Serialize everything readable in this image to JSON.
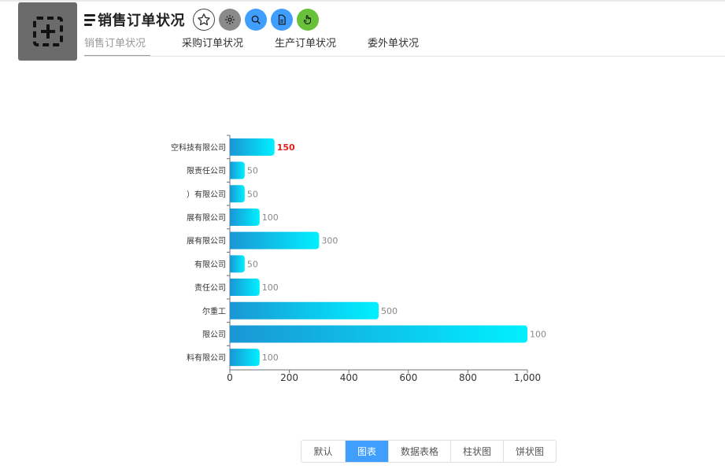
{
  "header": {
    "title": "销售订单状况",
    "actions": [
      {
        "id": "favorite",
        "icon": "star-icon"
      },
      {
        "id": "settings",
        "icon": "gear-icon"
      },
      {
        "id": "search",
        "icon": "search-icon"
      },
      {
        "id": "document",
        "icon": "document-icon"
      },
      {
        "id": "touch",
        "icon": "hand-pointer-icon"
      }
    ],
    "action_colors": {
      "settings": "#8a8a8a",
      "search": "#409eff",
      "document": "#409eff",
      "touch": "#67c23a"
    }
  },
  "tabs": [
    {
      "label": "销售订单状况",
      "active": true
    },
    {
      "label": "采购订单状况",
      "active": false
    },
    {
      "label": "生产订单状况",
      "active": false
    },
    {
      "label": "委外单状况",
      "active": false
    }
  ],
  "view_toggle": {
    "options": [
      "默认",
      "图表",
      "数据表格",
      "柱状图",
      "饼状图"
    ],
    "selected": "图表",
    "accent": "#409eff"
  },
  "chart_data": {
    "type": "bar",
    "orientation": "horizontal",
    "categories": [
      "空科技有限公司",
      "限责任公司",
      "）有限公司",
      "展有限公司",
      "展有限公司",
      "有限公司",
      "责任公司",
      "尔重工",
      "限公司",
      "料有限公司"
    ],
    "values": [
      150,
      50,
      50,
      100,
      300,
      50,
      100,
      500,
      1000,
      100
    ],
    "data_labels": [
      "150",
      "50",
      "50",
      "100",
      "300",
      "50",
      "100",
      "500",
      "100",
      "100"
    ],
    "highlight_index": 0,
    "highlight_color": "#e02020",
    "xlim": [
      0,
      1000
    ],
    "xticks": [
      0,
      200,
      400,
      600,
      800,
      1000
    ],
    "xtick_labels": [
      "0",
      "200",
      "400",
      "600",
      "800",
      "1,000"
    ],
    "bar_gradient": [
      "#1a96d4",
      "#00f0ff"
    ],
    "grid": false
  }
}
